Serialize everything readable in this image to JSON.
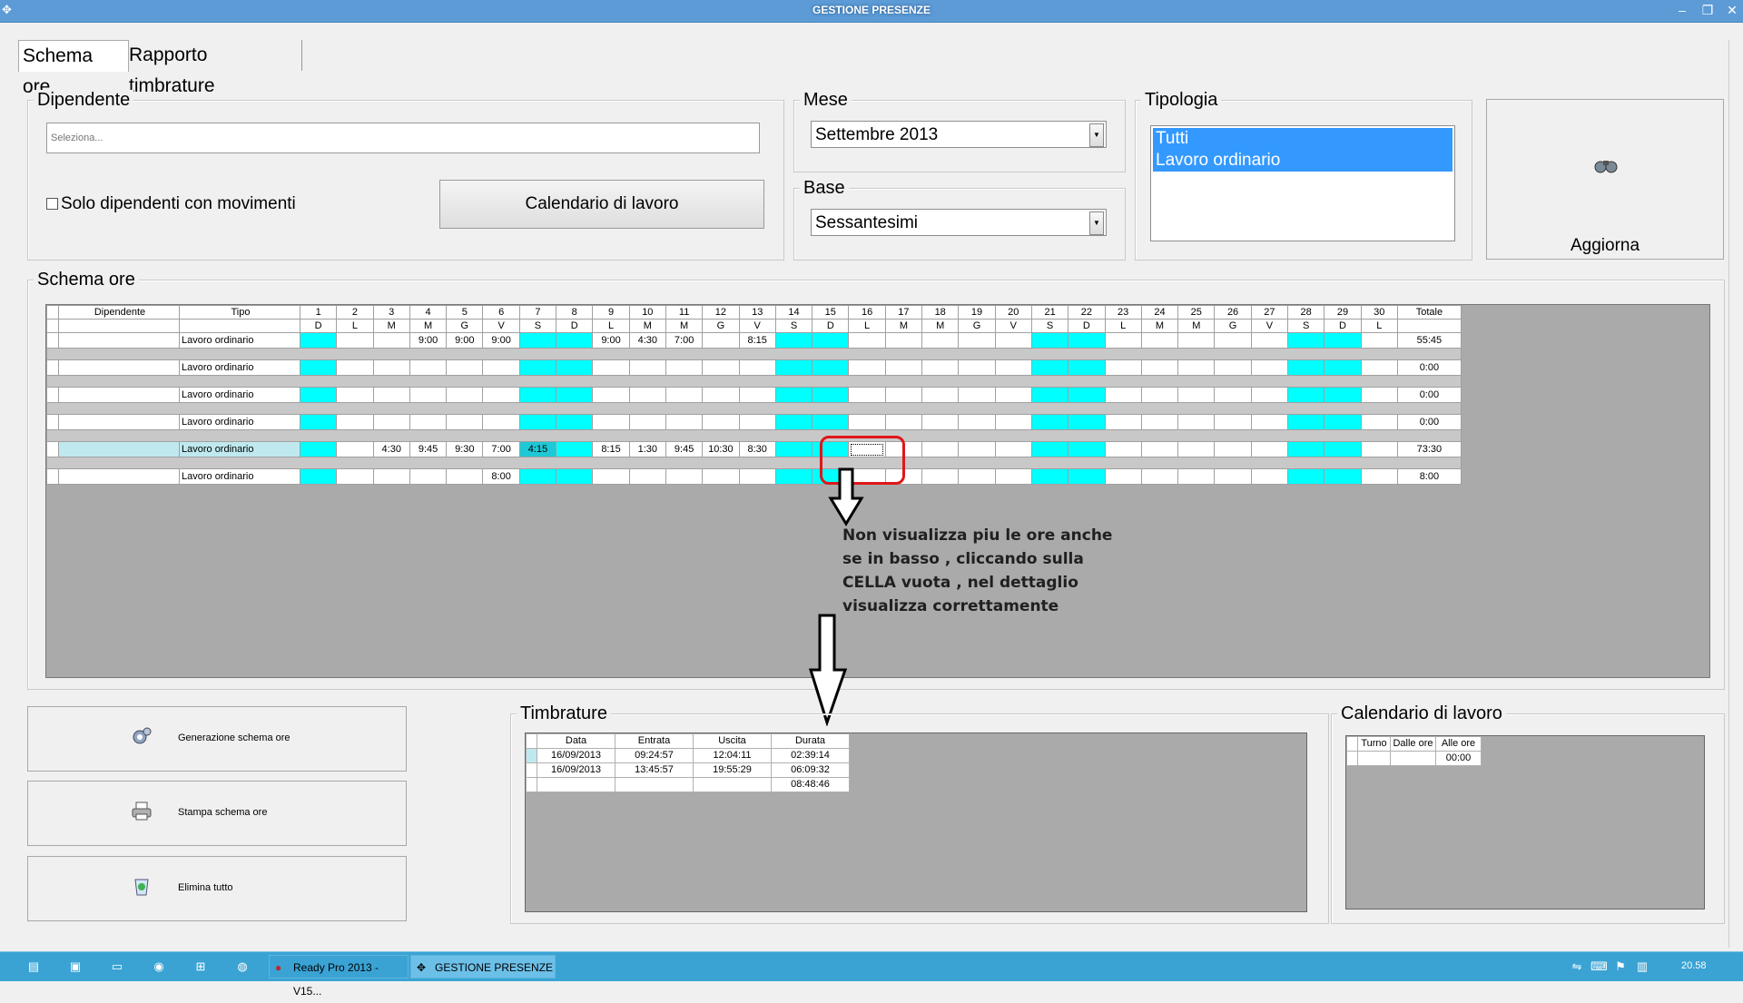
{
  "window": {
    "title": "GESTIONE PRESENZE"
  },
  "tabs": [
    "Schema ore",
    "Rapporto timbrature"
  ],
  "dipendente": {
    "label": "Dipendente",
    "placeholder": "Seleziona...",
    "checkbox_label": "Solo dipendenti con movimenti",
    "calendar_button": "Calendario di lavoro"
  },
  "mese": {
    "label": "Mese",
    "value": "Settembre 2013"
  },
  "base": {
    "label": "Base",
    "value": "Sessantesimi"
  },
  "tipologia": {
    "label": "Tipologia",
    "items": [
      "Tutti",
      "Lavoro ordinario"
    ]
  },
  "aggiorna": {
    "label": "Aggiorna"
  },
  "schema": {
    "label": "Schema ore",
    "col_dipendente": "Dipendente",
    "col_tipo": "Tipo",
    "col_totale": "Totale",
    "days": [
      "1",
      "2",
      "3",
      "4",
      "5",
      "6",
      "7",
      "8",
      "9",
      "10",
      "11",
      "12",
      "13",
      "14",
      "15",
      "16",
      "17",
      "18",
      "19",
      "20",
      "21",
      "22",
      "23",
      "24",
      "25",
      "26",
      "27",
      "28",
      "29",
      "30"
    ],
    "weekdays": [
      "D",
      "L",
      "M",
      "M",
      "G",
      "V",
      "S",
      "D",
      "L",
      "M",
      "M",
      "G",
      "V",
      "S",
      "D",
      "L",
      "M",
      "M",
      "G",
      "V",
      "S",
      "D",
      "L",
      "M",
      "M",
      "G",
      "V",
      "S",
      "D",
      "L"
    ],
    "rows": [
      {
        "tipo": "Lavoro ordinario",
        "values": [
          "",
          "",
          "",
          "9:00",
          "9:00",
          "9:00",
          "",
          "",
          "9:00",
          "4:30",
          "7:00",
          "",
          "8:15",
          "",
          "",
          "",
          "",
          "",
          "",
          "",
          "",
          "",
          "",
          "",
          "",
          "",
          "",
          "",
          "",
          ""
        ],
        "totale": "55:45"
      },
      {
        "tipo": "Lavoro ordinario",
        "values": [
          "",
          "",
          "",
          "",
          "",
          "",
          "",
          "",
          "",
          "",
          "",
          "",
          "",
          "",
          "",
          "",
          "",
          "",
          "",
          "",
          "",
          "",
          "",
          "",
          "",
          "",
          "",
          "",
          "",
          ""
        ],
        "totale": "0:00"
      },
      {
        "tipo": "Lavoro ordinario",
        "values": [
          "",
          "",
          "",
          "",
          "",
          "",
          "",
          "",
          "",
          "",
          "",
          "",
          "",
          "",
          "",
          "",
          "",
          "",
          "",
          "",
          "",
          "",
          "",
          "",
          "",
          "",
          "",
          "",
          "",
          ""
        ],
        "totale": "0:00"
      },
      {
        "tipo": "Lavoro ordinario",
        "values": [
          "",
          "",
          "",
          "",
          "",
          "",
          "",
          "",
          "",
          "",
          "",
          "",
          "",
          "",
          "",
          "",
          "",
          "",
          "",
          "",
          "",
          "",
          "",
          "",
          "",
          "",
          "",
          "",
          "",
          ""
        ],
        "totale": "0:00"
      },
      {
        "tipo": "Lavoro ordinario",
        "values": [
          "",
          "",
          "4:30",
          "9:45",
          "9:30",
          "7:00",
          "4:15",
          "",
          "8:15",
          "1:30",
          "9:45",
          "10:30",
          "8:30",
          "",
          "",
          "",
          "",
          "",
          "",
          "",
          "",
          "",
          "",
          "",
          "",
          "",
          "",
          "",
          "",
          ""
        ],
        "totale": "73:30"
      },
      {
        "tipo": "Lavoro ordinario",
        "values": [
          "",
          "",
          "",
          "",
          "",
          "8:00",
          "",
          "",
          "",
          "",
          "",
          "",
          "",
          "",
          "",
          "",
          "",
          "",
          "",
          "",
          "",
          "",
          "",
          "",
          "",
          "",
          "",
          "",
          "",
          ""
        ],
        "totale": "8:00"
      }
    ]
  },
  "annotation": {
    "text": "Non visualizza piu le ore anche se in basso , cliccando sulla CELLA vuota , nel dettaglio visualizza correttamente"
  },
  "left_buttons": [
    "Generazione schema ore",
    "Stampa schema ore",
    "Elimina tutto"
  ],
  "timbrature": {
    "label": "Timbrature",
    "headers": [
      "Data",
      "Entrata",
      "Uscita",
      "Durata"
    ],
    "rows": [
      [
        "16/09/2013",
        "09:24:57",
        "12:04:11",
        "02:39:14"
      ],
      [
        "16/09/2013",
        "13:45:57",
        "19:55:29",
        "06:09:32"
      ],
      [
        "",
        "",
        "",
        "08:48:46"
      ]
    ]
  },
  "calendario": {
    "label": "Calendario di lavoro",
    "headers": [
      "Turno",
      "Dalle ore",
      "Alle ore"
    ],
    "rows": [
      [
        "",
        "",
        "00:00"
      ]
    ]
  },
  "taskbar": {
    "tasks": [
      "Ready Pro 2013 - V15...",
      "GESTIONE PRESENZE"
    ],
    "clock": "20.58"
  },
  "colors": {
    "weekend": "#00ffff",
    "grid_bg": "#aaaaaa",
    "selection": "#3399ff",
    "annotation_box": "#e0161a",
    "taskbar": "#3aa3d4"
  }
}
